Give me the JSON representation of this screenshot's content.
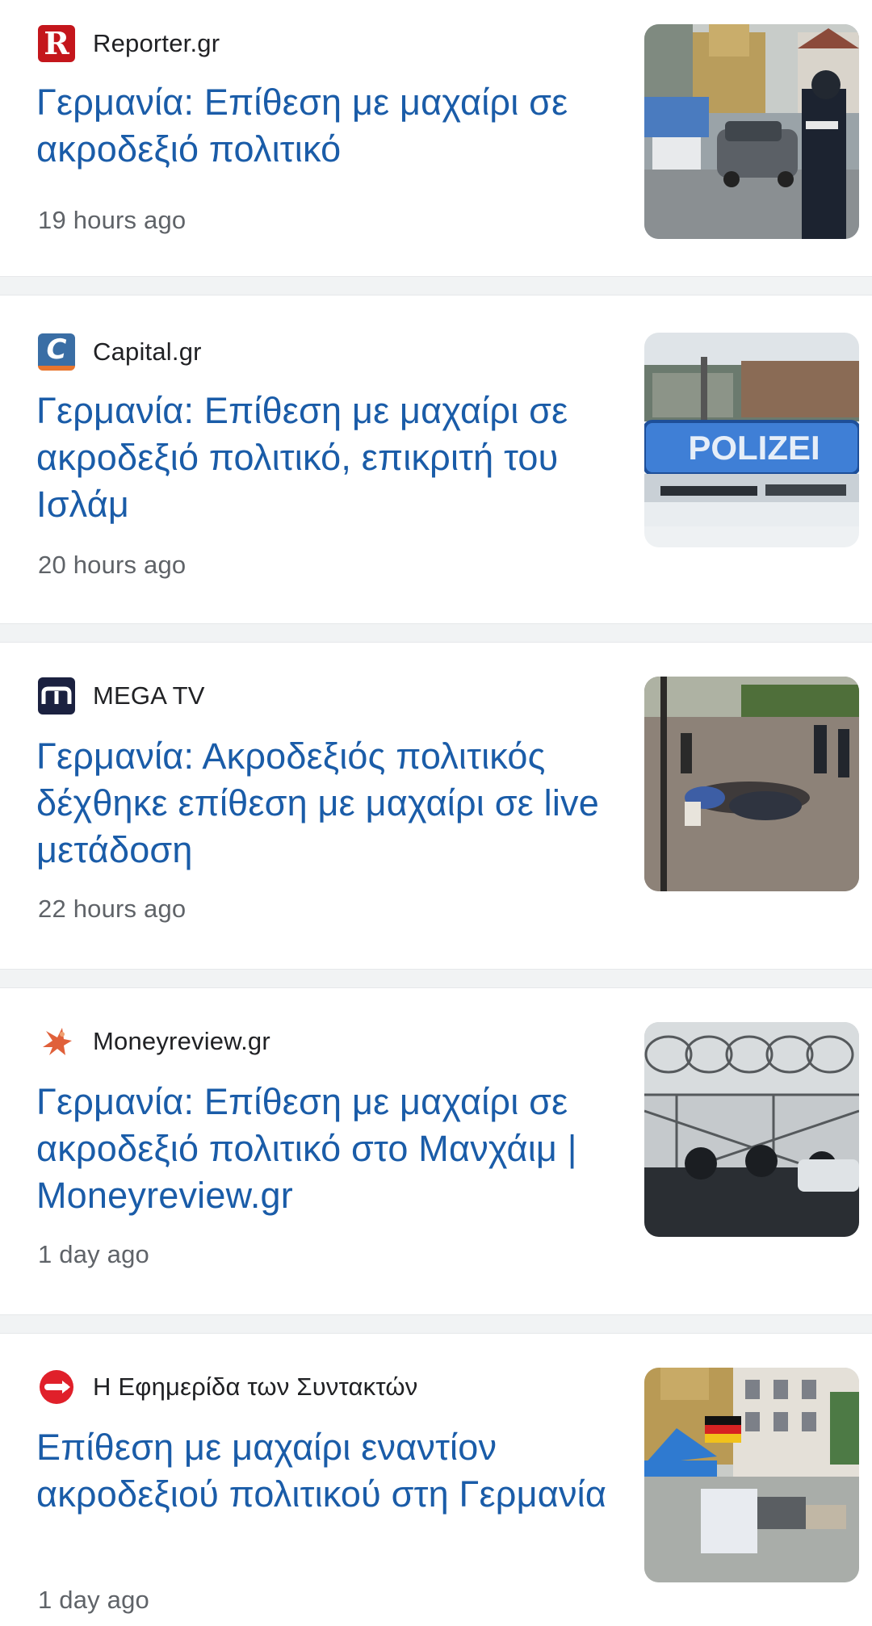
{
  "articles": [
    {
      "source": "Reporter.gr",
      "logo_icon": "reporter-r-icon",
      "headline": "Γερμανία: Επίθεση με μαχαίρι σε ακροδεξιό πολιτικό",
      "time": "19 hours ago",
      "thumbnail_icon": "street-police-car-photo"
    },
    {
      "source": "Capital.gr",
      "logo_icon": "capital-c-icon",
      "headline": "Γερμανία: Επίθεση με μαχαίρι σε ακροδεξιό πολιτικό, επικριτή του Ισλάμ",
      "time": "20 hours ago",
      "thumbnail_icon": "polizei-car-photo",
      "thumbnail_text": "POLIZEI"
    },
    {
      "source": "MEGA TV",
      "logo_icon": "mega-m-icon",
      "headline": "Γερμανία: Ακροδεξιός πολιτικός δέχθηκε επίθεση με μαχαίρι σε live μετάδοση",
      "time": "22 hours ago",
      "thumbnail_icon": "square-scuffle-photo"
    },
    {
      "source": "Moneyreview.gr",
      "logo_icon": "moneyreview-bird-icon",
      "headline": "Γερμανία: Επίθεση με μαχαίρι σε ακροδεξιό πολιτικό στο Μανχάιμ | Moneyreview.gr",
      "time": "1 day ago",
      "thumbnail_icon": "barbed-wire-police-photo"
    },
    {
      "source": "Η Εφημερίδα των Συντακτών",
      "logo_icon": "efsyn-circle-icon",
      "headline": "Επίθεση με μαχαίρι εναντίον ακροδεξιού πολιτικού στη Γερμανία",
      "time": "1 day ago",
      "thumbnail_icon": "market-square-flag-photo"
    }
  ],
  "colors": {
    "headline": "#1a5ca8",
    "source": "#202124",
    "time": "#5f6368",
    "separator": "#f1f3f4"
  }
}
